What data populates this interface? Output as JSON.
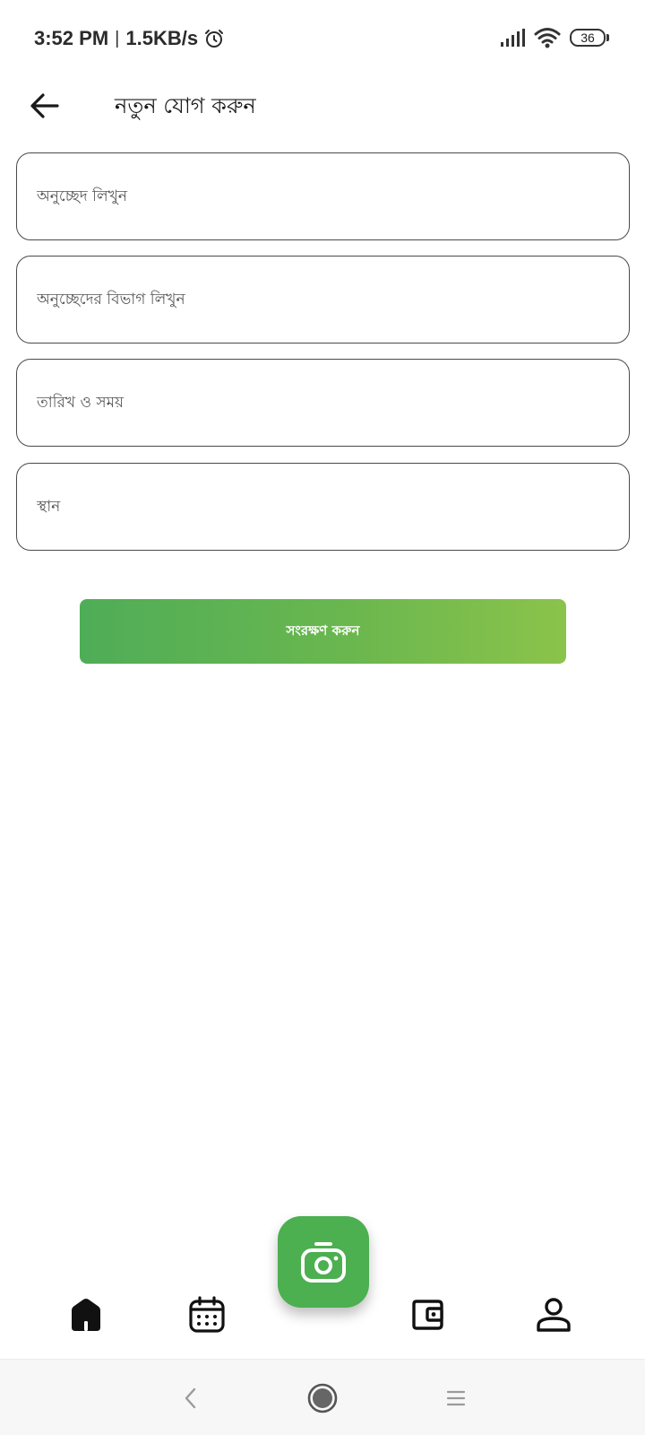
{
  "status_bar": {
    "time": "3:52 PM",
    "separator": "|",
    "network_speed": "1.5KB/s",
    "battery_level": "36",
    "icons": [
      "alarm-icon",
      "signal-icon",
      "wifi-icon",
      "battery-icon"
    ]
  },
  "header": {
    "title": "নতুন যোগ করুন",
    "back_icon": "arrow-left-icon"
  },
  "form": {
    "fields": [
      {
        "placeholder": "অনুচ্ছেদ লিখুন",
        "value": ""
      },
      {
        "placeholder": "অনুচ্ছেদের বিভাগ লিখুন",
        "value": ""
      },
      {
        "placeholder": "তারিখ ও সময়",
        "value": ""
      },
      {
        "placeholder": "স্থান",
        "value": ""
      }
    ],
    "save_label": "সংরক্ষণ করুন"
  },
  "bottom_nav": {
    "items": [
      "home-icon",
      "calendar-icon",
      "camera-icon",
      "wallet-icon",
      "profile-icon"
    ]
  },
  "colors": {
    "accent": "#4caf50",
    "gradient_start": "#4fad57",
    "gradient_end": "#8bc34a",
    "field_border": "#4a4a4a"
  }
}
